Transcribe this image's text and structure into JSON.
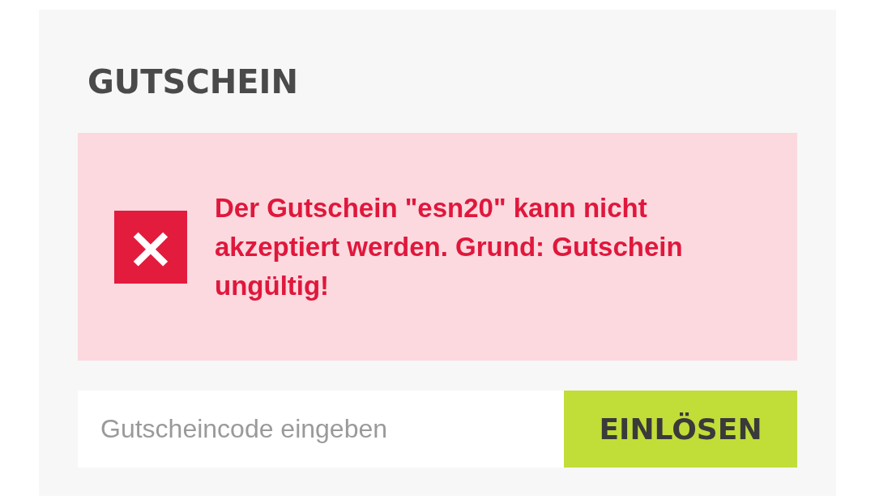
{
  "voucher": {
    "title": "GUTSCHEIN",
    "error": {
      "icon": "×",
      "message": "Der Gutschein \"esn20\" kann nicht akzeptiert werden. Grund: Gutschein ungültig!"
    },
    "input": {
      "placeholder": "Gutscheincode eingeben"
    },
    "button": {
      "label": "EINLÖSEN"
    }
  }
}
